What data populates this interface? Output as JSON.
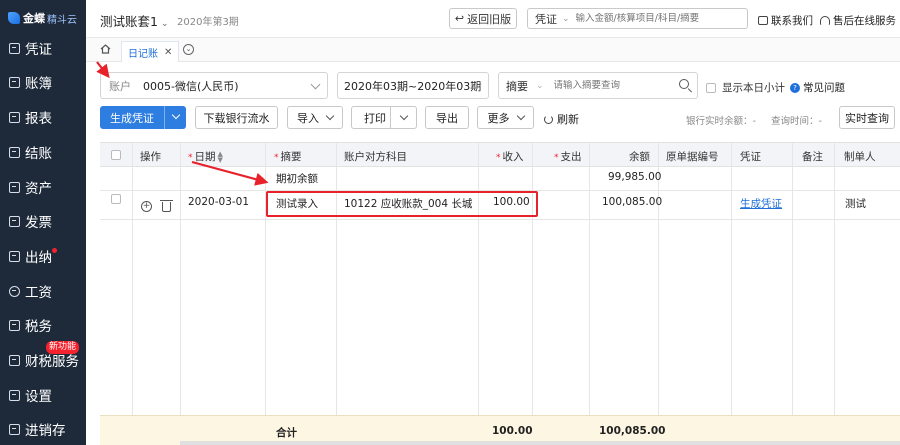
{
  "brand": {
    "name": "金蝶",
    "sub": "精斗云"
  },
  "sidebar": {
    "items": [
      {
        "label": "凭证",
        "icon": "voucher-icon"
      },
      {
        "label": "账簿",
        "icon": "ledger-icon"
      },
      {
        "label": "报表",
        "icon": "report-icon"
      },
      {
        "label": "结账",
        "icon": "close-account-icon"
      },
      {
        "label": "资产",
        "icon": "asset-icon"
      },
      {
        "label": "发票",
        "icon": "invoice-icon"
      },
      {
        "label": "出纳",
        "icon": "cashier-icon"
      },
      {
        "label": "工资",
        "icon": "salary-icon"
      },
      {
        "label": "税务",
        "icon": "tax-icon"
      },
      {
        "label": "财税服务",
        "icon": "tax-service-icon"
      },
      {
        "label": "设置",
        "icon": "settings-icon"
      },
      {
        "label": "进销存",
        "icon": "inventory-icon"
      }
    ],
    "new_badge": "新功能"
  },
  "topbar": {
    "account_set": "测试账套1",
    "period": "2020年第3期",
    "back_old": "返回旧版",
    "voucher_type": "凭证",
    "voucher_placeholder": "输入金额/核算项目/科目/摘要",
    "contact": "联系我们",
    "support": "售后在线服务"
  },
  "tabs": {
    "active": "日记账"
  },
  "filters": {
    "account_label": "账户",
    "account_value": "0005-微信(人民币)",
    "period_range": "2020年03期~2020年03期",
    "summary_type": "摘要",
    "summary_placeholder": "请输入摘要查询",
    "daily_subtotal": "显示本日小计",
    "faq": "常见问题"
  },
  "toolbar": {
    "generate_voucher": "生成凭证",
    "download_bank": "下载银行流水",
    "import": "导入",
    "print": "打印",
    "export": "导出",
    "more": "更多",
    "refresh": "刷新",
    "bank_balance": "银行实时余额：",
    "bank_balance_value": "-",
    "query_time": "查询时间：",
    "query_time_value": "-",
    "realtime_query": "实时查询"
  },
  "table": {
    "headers": {
      "action": "操作",
      "date": "日期",
      "summary": "摘要",
      "counter_account": "账户对方科目",
      "income": "收入",
      "expense": "支出",
      "balance": "余额",
      "doc_no": "原单据编号",
      "voucher": "凭证",
      "remark": "备注",
      "creator": "制单人"
    },
    "opening": {
      "summary": "期初余额",
      "balance": "99,985.00"
    },
    "row": {
      "date": "2020-03-01",
      "summary": "测试录入",
      "counter_account": "10122 应收账款_004 长城...",
      "income": "100.00",
      "balance": "100,085.00",
      "voucher": "生成凭证",
      "creator": "测试"
    },
    "total": {
      "label": "合计",
      "income": "100.00",
      "balance": "100,085.00"
    }
  }
}
